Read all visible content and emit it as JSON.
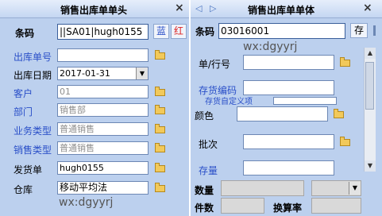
{
  "left_panel": {
    "title": "销售出库单单头",
    "close": "×",
    "barcode": {
      "label": "条码",
      "value": "||SA01|hugh0155",
      "blue_button": "蓝",
      "red_button": "红"
    },
    "fields": [
      {
        "label": "出库单号",
        "value": ""
      },
      {
        "label": "出库日期",
        "value": "2017-01-31"
      },
      {
        "label": "客户",
        "value": "01"
      },
      {
        "label": "部门",
        "value": "销售部"
      },
      {
        "label": "业务类型",
        "value": "普通销售"
      },
      {
        "label": "销售类型",
        "value": "普通销售"
      },
      {
        "label": "发货单",
        "value": "hugh0155"
      },
      {
        "label": "仓库",
        "value": "移动平均法"
      }
    ],
    "watermark": "wx:dgyyrj"
  },
  "right_panel": {
    "title": "销售出库单单体",
    "close": "×",
    "barcode": {
      "label": "条码",
      "value": "03016001",
      "save_button": "存"
    },
    "watermark": "wx:dgyyrj",
    "fields": [
      {
        "label": "单/行号",
        "value": ""
      },
      {
        "label": "存货编码",
        "value": ""
      },
      {
        "label": "颜色",
        "value": ""
      },
      {
        "label": "批次",
        "value": ""
      },
      {
        "label": "存量",
        "value": ""
      }
    ],
    "overlap_text": "存货自定义项",
    "bottom": {
      "qty_label": "数量",
      "pieces_label": "件数",
      "rate_label": "换算率"
    }
  }
}
